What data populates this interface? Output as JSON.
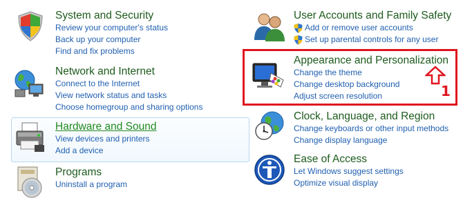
{
  "left_column": [
    {
      "title": "System and Security",
      "icon": "shield-icon",
      "links": [
        "Review your computer's status",
        "Back up your computer",
        "Find and fix problems"
      ]
    },
    {
      "title": "Network and Internet",
      "icon": "network-globe-icon",
      "links": [
        "Connect to the Internet",
        "View network status and tasks",
        "Choose homegroup and sharing options"
      ]
    },
    {
      "title": "Hardware and Sound",
      "icon": "printer-icon",
      "links": [
        "View devices and printers",
        "Add a device"
      ],
      "highlighted": true
    },
    {
      "title": "Programs",
      "icon": "programs-disc-icon",
      "links": [
        "Uninstall a program"
      ]
    }
  ],
  "right_column": [
    {
      "title": "User Accounts and Family Safety",
      "icon": "users-icon",
      "links": [
        "Add or remove user accounts",
        "Set up parental controls for any user"
      ],
      "links_have_shield": true
    },
    {
      "title": "Appearance and Personalization",
      "icon": "monitor-palette-icon",
      "links": [
        "Change the theme",
        "Change desktop background",
        "Adjust screen resolution"
      ],
      "annotated": true
    },
    {
      "title": "Clock, Language, and Region",
      "icon": "clock-globe-icon",
      "links": [
        "Change keyboards or other input methods",
        "Change display language"
      ]
    },
    {
      "title": "Ease of Access",
      "icon": "ease-of-access-icon",
      "links": [
        "Let Windows suggest settings",
        "Optimize visual display"
      ]
    }
  ],
  "annotation": {
    "number": "1",
    "color": "#e0141e"
  },
  "colors": {
    "title_green": "#1e5b1e",
    "hover_green": "#1f8a1f",
    "link_blue": "#1f5fb0",
    "highlight_border": "#b9d7f0"
  }
}
